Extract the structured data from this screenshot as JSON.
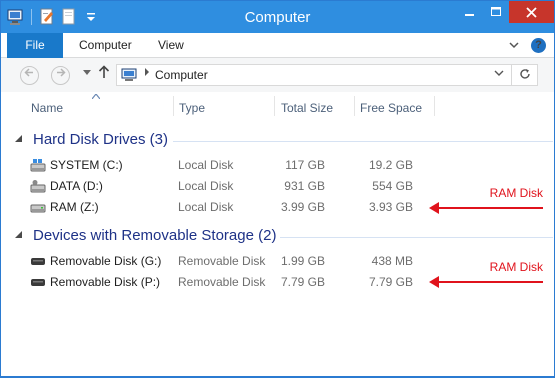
{
  "window": {
    "title": "Computer",
    "controls": [
      "minimize",
      "maximize",
      "close"
    ],
    "accent": "#2f8ee0"
  },
  "ribbon": {
    "tabs": [
      {
        "label": "File"
      },
      {
        "label": "Computer"
      },
      {
        "label": "View"
      }
    ],
    "help": "?"
  },
  "nav": {
    "address": "Computer"
  },
  "columns": [
    "Name",
    "Type",
    "Total Size",
    "Free Space"
  ],
  "groups": [
    {
      "title": "Hard Disk Drives (3)",
      "items": [
        {
          "name": "SYSTEM (C:)",
          "type": "Local Disk",
          "total": "117 GB",
          "free": "19.2 GB",
          "icon": "windows-drive-icon"
        },
        {
          "name": "DATA (D:)",
          "type": "Local Disk",
          "total": "931 GB",
          "free": "554 GB",
          "icon": "hard-drive-icon"
        },
        {
          "name": "RAM (Z:)",
          "type": "Local Disk",
          "total": "3.99 GB",
          "free": "3.93 GB",
          "icon": "drive-icon"
        }
      ]
    },
    {
      "title": "Devices with Removable Storage (2)",
      "items": [
        {
          "name": "Removable Disk (G:)",
          "type": "Removable Disk",
          "total": "1.99 GB",
          "free": "438 MB",
          "icon": "removable-drive-icon"
        },
        {
          "name": "Removable Disk (P:)",
          "type": "Removable Disk",
          "total": "7.79 GB",
          "free": "7.79 GB",
          "icon": "removable-drive-icon"
        }
      ]
    }
  ],
  "annotations": [
    {
      "label": "RAM Disk",
      "color": "#e0131c"
    },
    {
      "label": "RAM Disk",
      "color": "#e0131c"
    }
  ]
}
